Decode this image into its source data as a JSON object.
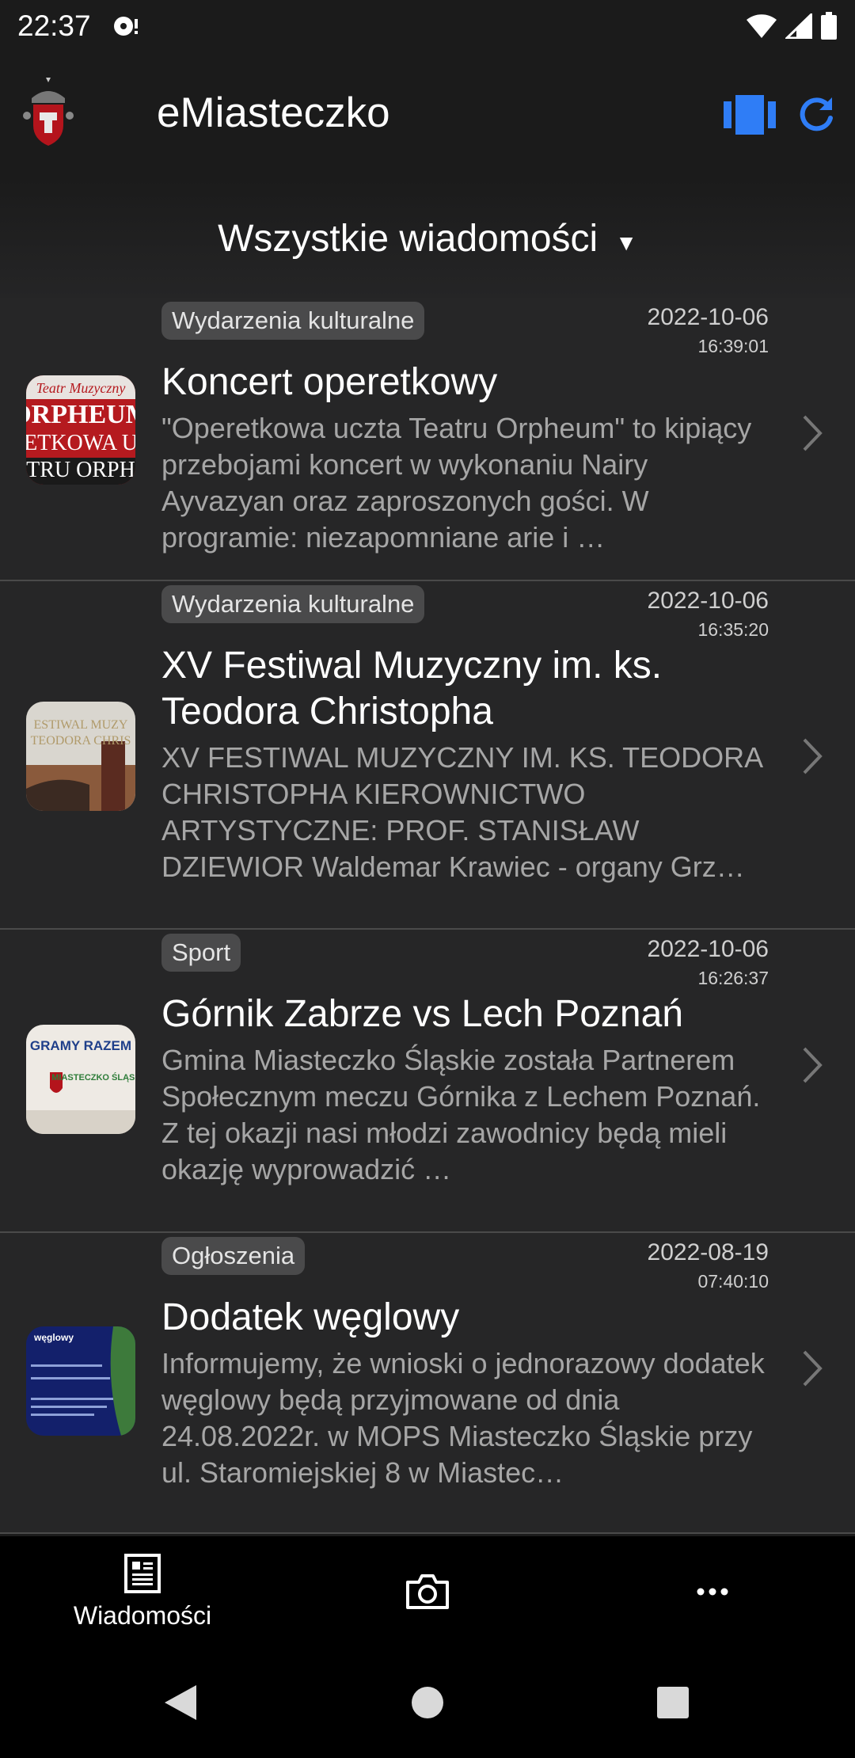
{
  "status": {
    "time": "22:37"
  },
  "app": {
    "title": "eMiasteczko"
  },
  "filter": {
    "label": "Wszystkie wiadomości"
  },
  "news": [
    {
      "category": "Wydarzenia kulturalne",
      "date": "2022-10-06",
      "time": "16:39:01",
      "title": "Koncert operetkowy",
      "excerpt": "\"Operetkowa uczta Teatru Orpheum\" to kipiący przebojami koncert w wykonaniu Nairy Ayvazyan oraz zaproszonych gości. W programie: niezapomniane arie i …",
      "thumb_text": [
        "Teatr Muzyczny",
        "ORPHEUM",
        "ETKOWA U",
        "TRU ORPH"
      ]
    },
    {
      "category": "Wydarzenia kulturalne",
      "date": "2022-10-06",
      "time": "16:35:20",
      "title": "XV Festiwal Muzyczny im. ks. Teodora Christopha",
      "excerpt": "XV FESTIWAL MUZYCZNY IM. KS. TEODORA CHRISTOPHA KIEROWNICTWO ARTYSTYCZNE: PROF. STANISŁAW DZIEWIOR Waldemar Krawiec - organy Grz…",
      "thumb_text": [
        "ESTIWAL MUZY",
        "TEODORA CHRIS"
      ]
    },
    {
      "category": "Sport",
      "date": "2022-10-06",
      "time": "16:26:37",
      "title": "Górnik Zabrze vs Lech Poznań",
      "excerpt": "Gmina Miasteczko Śląskie została Partnerem Społecznym meczu Górnika z Lechem Poznań. Z tej okazji nasi młodzi zawodnicy będą mieli okazję wyprowadzić …",
      "thumb_text": [
        "GRAMY RAZEM",
        "MIASTECZKO ŚLĄSKIE"
      ]
    },
    {
      "category": "Ogłoszenia",
      "date": "2022-08-19",
      "time": "07:40:10",
      "title": "Dodatek węglowy",
      "excerpt": "Informujemy, że wnioski o jednorazowy dodatek węglowy będą przyjmowane od dnia 24.08.2022r. w MOPS Miasteczko Śląskie przy ul. Staromiejskiej 8 w Miastec…",
      "thumb_text": [
        "węglowy"
      ]
    }
  ],
  "tabs": {
    "news": "Wiadomości"
  },
  "colors": {
    "accent": "#2f7df6",
    "background": "#1b1b1b",
    "card": "#262627"
  }
}
